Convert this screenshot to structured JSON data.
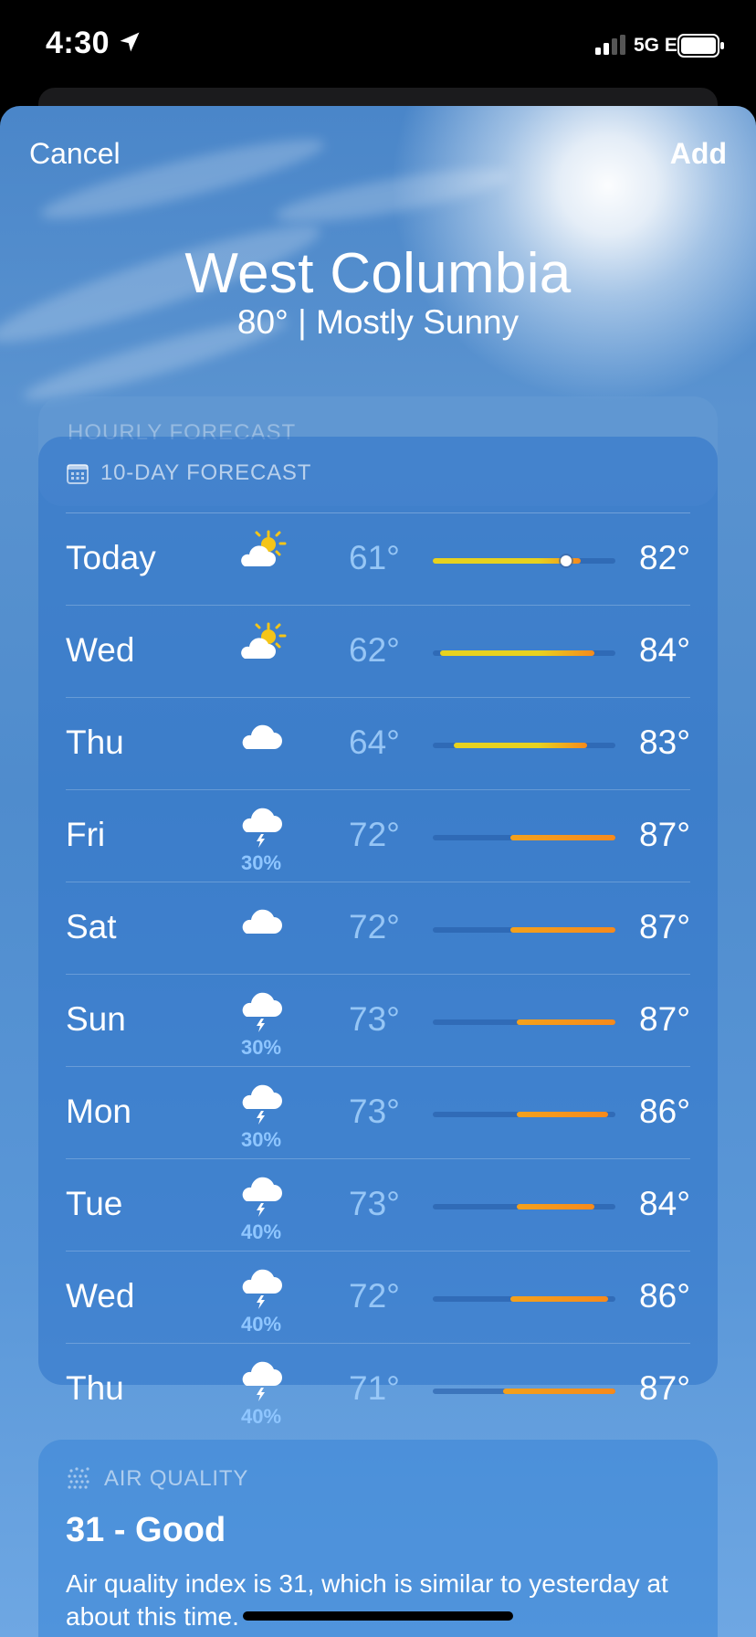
{
  "status_bar": {
    "time": "4:30",
    "network": "5G E"
  },
  "nav": {
    "cancel_label": "Cancel",
    "add_label": "Add"
  },
  "location": {
    "city": "West Columbia",
    "summary": "80°  |  Mostly Sunny"
  },
  "hourly": {
    "label": "HOURLY FORECAST"
  },
  "forecast": {
    "label": "10-DAY FORECAST",
    "scale_min": 61,
    "scale_max": 87,
    "days": [
      {
        "day": "Today",
        "icon": "partly-sunny-icon",
        "precip": "",
        "low": "61°",
        "high": "82°",
        "low_val": 61,
        "high_val": 82,
        "current": 80
      },
      {
        "day": "Wed",
        "icon": "partly-sunny-icon",
        "precip": "",
        "low": "62°",
        "high": "84°",
        "low_val": 62,
        "high_val": 84
      },
      {
        "day": "Thu",
        "icon": "cloud-icon",
        "precip": "",
        "low": "64°",
        "high": "83°",
        "low_val": 64,
        "high_val": 83
      },
      {
        "day": "Fri",
        "icon": "thunderstorm-icon",
        "precip": "30%",
        "low": "72°",
        "high": "87°",
        "low_val": 72,
        "high_val": 87
      },
      {
        "day": "Sat",
        "icon": "cloud-icon",
        "precip": "",
        "low": "72°",
        "high": "87°",
        "low_val": 72,
        "high_val": 87
      },
      {
        "day": "Sun",
        "icon": "thunderstorm-icon",
        "precip": "30%",
        "low": "73°",
        "high": "87°",
        "low_val": 73,
        "high_val": 87
      },
      {
        "day": "Mon",
        "icon": "thunderstorm-icon",
        "precip": "30%",
        "low": "73°",
        "high": "86°",
        "low_val": 73,
        "high_val": 86
      },
      {
        "day": "Tue",
        "icon": "thunderstorm-icon",
        "precip": "40%",
        "low": "73°",
        "high": "84°",
        "low_val": 73,
        "high_val": 84
      },
      {
        "day": "Wed",
        "icon": "thunderstorm-icon",
        "precip": "40%",
        "low": "72°",
        "high": "86°",
        "low_val": 72,
        "high_val": 86
      },
      {
        "day": "Thu",
        "icon": "thunderstorm-icon",
        "precip": "40%",
        "low": "71°",
        "high": "87°",
        "low_val": 71,
        "high_val": 87
      }
    ]
  },
  "air_quality": {
    "label": "AIR QUALITY",
    "value": "31 - Good",
    "description": "Air quality index is 31, which is similar to yesterday at about this time."
  },
  "colors": {
    "sky_top": "#4a86c9",
    "card": "#2d73c8",
    "low_temp": "#a0cdfa",
    "bar_cool": "#e8d21e",
    "bar_warm": "#f68a1c",
    "precip": "#8fc6ff"
  }
}
